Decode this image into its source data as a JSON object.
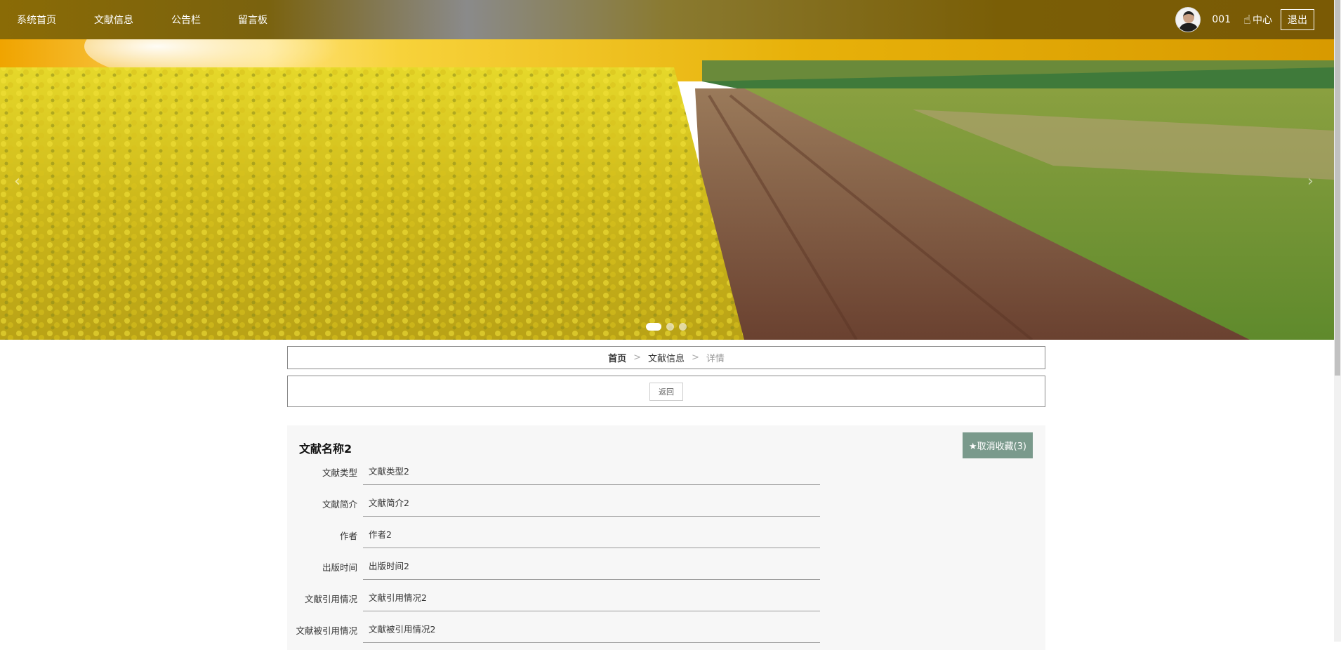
{
  "nav": {
    "items": [
      {
        "label": "系统首页"
      },
      {
        "label": "文献信息"
      },
      {
        "label": "公告栏"
      },
      {
        "label": "留言板"
      }
    ]
  },
  "user": {
    "name": "001",
    "center_label": "中心",
    "logout_label": "退出"
  },
  "banner": {
    "prev_icon": "‹",
    "next_icon": "›",
    "active_slide": 1,
    "slide_count": 3
  },
  "breadcrumb": {
    "home": "首页",
    "section": "文献信息",
    "current": "详情",
    "separator": ">"
  },
  "back_button": "返回",
  "detail": {
    "title": "文献名称2",
    "favorite_button": "★取消收藏(3)",
    "fields": [
      {
        "label": "文献类型",
        "value": "文献类型2"
      },
      {
        "label": "文献简介",
        "value": "文献简介2"
      },
      {
        "label": "作者",
        "value": "作者2"
      },
      {
        "label": "出版时间",
        "value": "出版时间2"
      },
      {
        "label": "文献引用情况",
        "value": "文献引用情况2"
      },
      {
        "label": "文献被引用情况",
        "value": "文献被引用情况2"
      }
    ]
  },
  "colors": {
    "nav_bg": "#7a6008",
    "favorite_button_bg": "#7a9a8c",
    "panel_bg": "#f7f7f7",
    "border": "#8a8a8a"
  }
}
